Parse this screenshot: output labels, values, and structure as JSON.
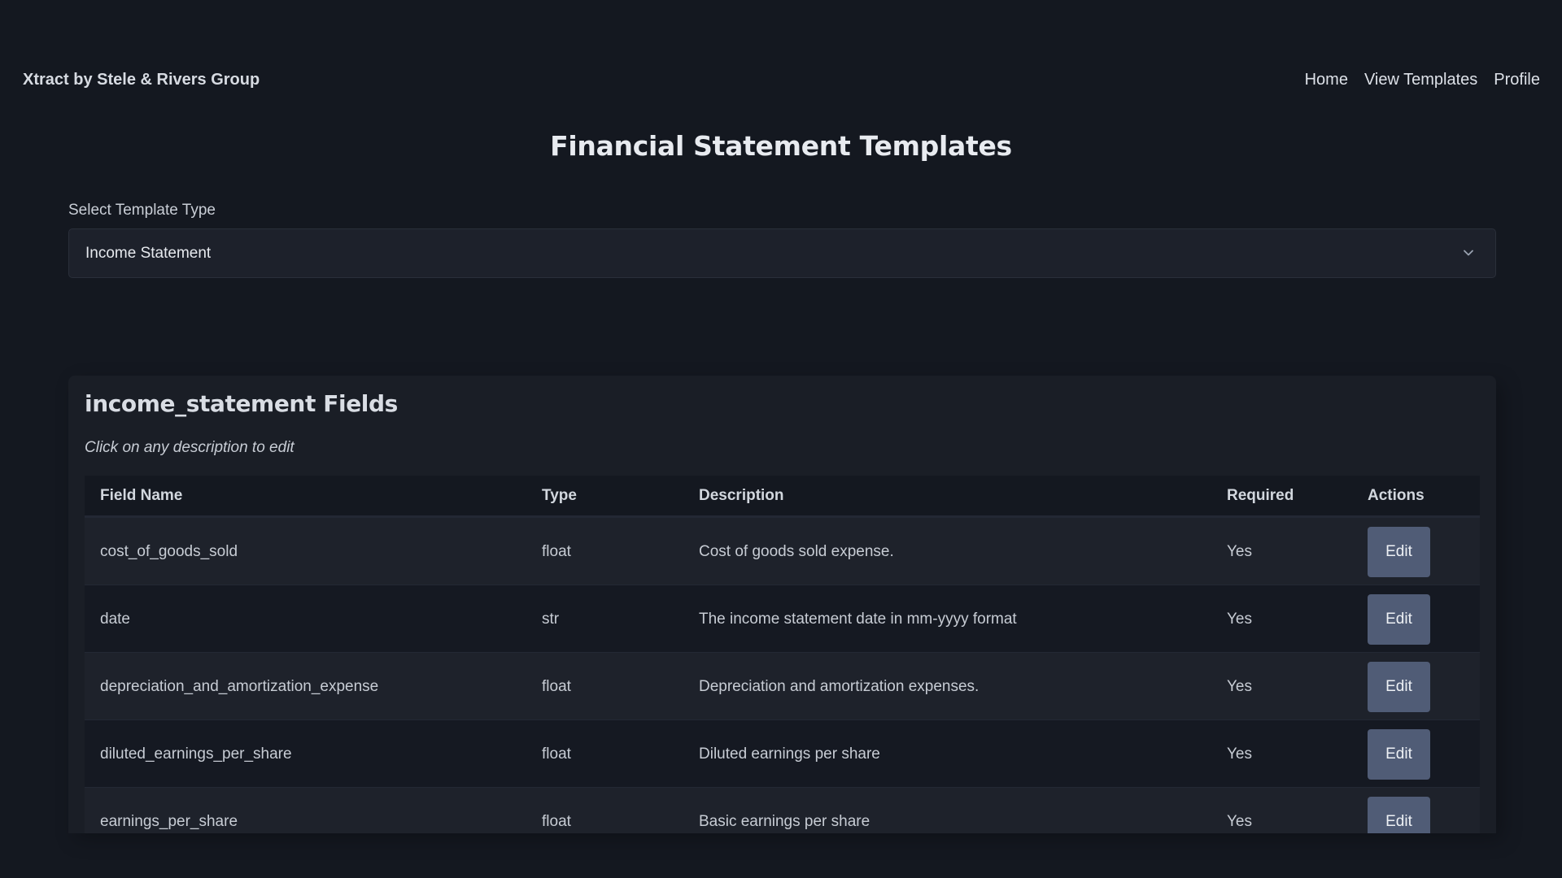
{
  "header": {
    "brand": "Xtract by Stele & Rivers Group",
    "nav": [
      {
        "label": "Home"
      },
      {
        "label": "View Templates"
      },
      {
        "label": "Profile"
      }
    ]
  },
  "page": {
    "title": "Financial Statement Templates"
  },
  "template_select": {
    "label": "Select Template Type",
    "value": "Income Statement",
    "icon": "chevron-down-icon"
  },
  "fields_panel": {
    "title": "income_statement Fields",
    "note": "Click on any description to edit",
    "columns": [
      "Field Name",
      "Type",
      "Description",
      "Required",
      "Actions"
    ],
    "rows": [
      {
        "field_name": "cost_of_goods_sold",
        "type": "float",
        "description": "Cost of goods sold expense.",
        "required": "Yes",
        "action": "Edit"
      },
      {
        "field_name": "date",
        "type": "str",
        "description": "The income statement date in mm-yyyy format",
        "required": "Yes",
        "action": "Edit"
      },
      {
        "field_name": "depreciation_and_amortization_expense",
        "type": "float",
        "description": "Depreciation and amortization expenses.",
        "required": "Yes",
        "action": "Edit"
      },
      {
        "field_name": "diluted_earnings_per_share",
        "type": "float",
        "description": "Diluted earnings per share",
        "required": "Yes",
        "action": "Edit"
      },
      {
        "field_name": "earnings_per_share",
        "type": "float",
        "description": "Basic earnings per share",
        "required": "Yes",
        "action": "Edit"
      }
    ]
  },
  "colors": {
    "background": "#141820",
    "panel": "#1a1e26",
    "edit_button": "#505c76"
  }
}
